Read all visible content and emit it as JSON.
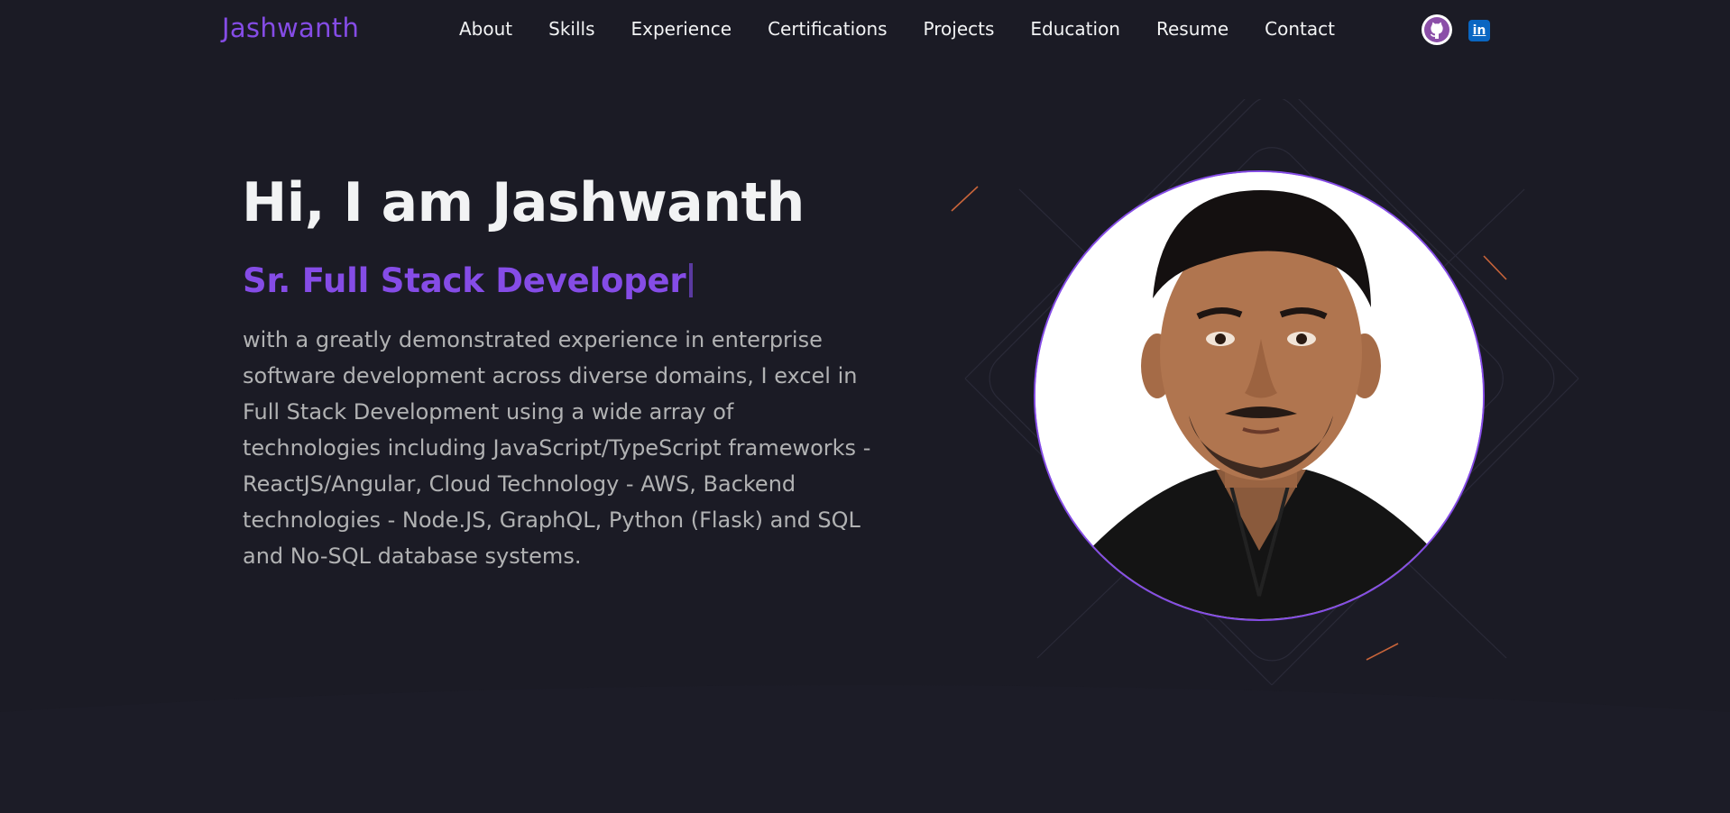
{
  "header": {
    "logo": "Jashwanth",
    "nav": [
      "About",
      "Skills",
      "Experience",
      "Certifications",
      "Projects",
      "Education",
      "Resume",
      "Contact"
    ],
    "social": {
      "github_icon": "github-icon",
      "linkedin_icon": "linkedin-icon",
      "linkedin_glyph": "in"
    }
  },
  "hero": {
    "title": "Hi, I am Jashwanth",
    "role": "Sr. Full Stack Developer",
    "description": "with a greatly demonstrated experience in enterprise software development across diverse domains, I excel in Full Stack Development using a wide array of technologies including JavaScript/TypeScript frameworks - ReactJS/Angular, Cloud Technology - AWS, Backend technologies - Node.JS, GraphQL, Python (Flask) and SQL and No-SQL database systems."
  },
  "colors": {
    "background": "#1b1b25",
    "accent": "#854ce6",
    "text_primary": "#f2f3f4",
    "text_secondary": "#b1b2b3",
    "linkedin": "#0a66c2"
  }
}
